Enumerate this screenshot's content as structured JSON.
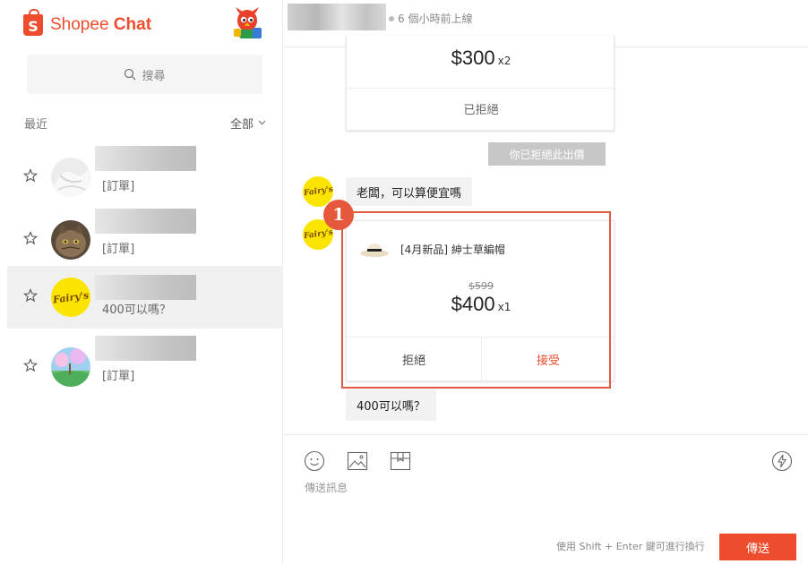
{
  "brand": {
    "icon_letter": "S",
    "name_light": "Shopee",
    "name_bold": "Chat",
    "color": "#ee4d2d"
  },
  "sidebar": {
    "search_placeholder": "搜尋",
    "recent_label": "最近",
    "filter_label": "全部",
    "conversations": [
      {
        "preview": "[訂單]",
        "avatar": "white-fabric-photo",
        "active": false
      },
      {
        "preview": "[訂單]",
        "avatar": "cat-photo",
        "active": false
      },
      {
        "preview": "400可以嗎？",
        "avatar": "fairys-logo",
        "active": true
      },
      {
        "preview": "[訂單]",
        "avatar": "landscape-photo",
        "active": false
      }
    ]
  },
  "header": {
    "status": "6 個小時前上線"
  },
  "messages": {
    "offer_previous": {
      "price": "$300",
      "qty": "x2",
      "status": "已拒絕"
    },
    "rejected_note": "你已拒絕此出價",
    "buyer_question": "老闆，可以算便宜嗎",
    "offer_current": {
      "product_name": "[4月新品] 紳士草編帽",
      "original_price": "$599",
      "price": "$400",
      "qty": "x1",
      "reject_label": "拒絕",
      "accept_label": "接受"
    },
    "buyer_followup": "400可以嗎？",
    "annotation_number": "1",
    "avatar_text": "Fairy's"
  },
  "composer": {
    "placeholder": "傳送訊息",
    "hint": "使用 Shift + Enter 鍵可進行換行",
    "send_label": "傳送"
  },
  "colors": {
    "accent": "#ee4d2d",
    "highlight": "#e05a3f",
    "avatar_yellow": "#fbe500"
  }
}
